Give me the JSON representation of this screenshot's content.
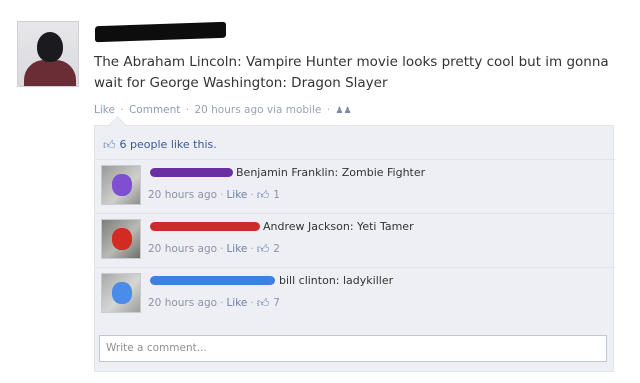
{
  "post": {
    "text": "The Abraham Lincoln: Vampire Hunter movie looks pretty cool but im gonna wait for George Washington: Dragon Slayer",
    "meta": {
      "like": "Like",
      "comment": "Comment",
      "time": "20 hours ago via mobile",
      "sep": "·",
      "audience_icon": "people-icon"
    }
  },
  "likes": {
    "icon": "thumbs-up-icon",
    "text": "6 people like this."
  },
  "comments": [
    {
      "text": "Benjamin Franklin: Zombie Fighter",
      "time": "20 hours ago",
      "like": "Like",
      "likes": "1",
      "redaction_color": "#6b2fa3",
      "avatar_blot_color": "#7e4fd0"
    },
    {
      "text": "Andrew Jackson: Yeti Tamer",
      "time": "20 hours ago",
      "like": "Like",
      "likes": "2",
      "redaction_color": "#d12a2a",
      "avatar_blot_color": "#d22b22"
    },
    {
      "text": "bill clinton: ladykiller",
      "time": "20 hours ago",
      "like": "Like",
      "likes": "7",
      "redaction_color": "#3f7fe0",
      "avatar_blot_color": "#4a8ce8"
    }
  ],
  "composer": {
    "placeholder": "Write a comment..."
  }
}
